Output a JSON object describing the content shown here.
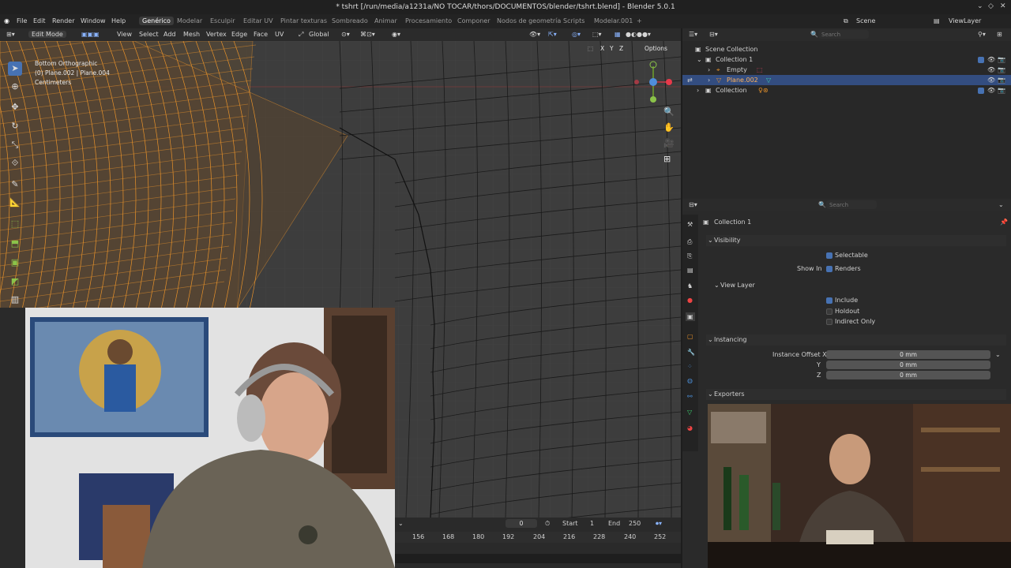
{
  "window": {
    "title": "* tshrt [/run/media/a1231a/NO TOCAR/thors/DOCUMENTOS/blender/tshrt.blend] - Blender 5.0.1"
  },
  "menu": {
    "items": [
      "File",
      "Edit",
      "Render",
      "Window",
      "Help"
    ],
    "workspaces": [
      "Genérico",
      "Modelar",
      "Esculpir",
      "Editar UV",
      "Pintar texturas",
      "Sombreado",
      "Animar",
      "Procesamiento",
      "Componer",
      "Nodos de geometría",
      "Scripts",
      "Modelar.001"
    ],
    "add_tab": "+",
    "scene_label": "Scene",
    "viewlayer_label": "ViewLayer"
  },
  "viewport_header": {
    "mode": "Edit Mode",
    "menus": [
      "View",
      "Select",
      "Add",
      "Mesh",
      "Vertex",
      "Edge",
      "Face",
      "UV"
    ],
    "orientation": "Global",
    "axes": [
      "X",
      "Y",
      "Z"
    ],
    "options_label": "Options"
  },
  "viewport": {
    "view_name": "Bottom Orthographic",
    "object_info": "(0) Plane.002 | Plane.004",
    "units": "Centimeters"
  },
  "outliner": {
    "search_placeholder": "Search",
    "root": "Scene Collection",
    "rows": [
      {
        "label": "Collection 1"
      },
      {
        "label": "Empty"
      },
      {
        "label": "Plane.002"
      },
      {
        "label": "Collection"
      }
    ]
  },
  "properties": {
    "search_placeholder": "Search",
    "context_title": "Collection 1",
    "visibility": {
      "header": "Visibility",
      "selectable": "Selectable",
      "show_in": "Show In",
      "renders": "Renders"
    },
    "view_layer": {
      "header": "View Layer",
      "include": "Include",
      "holdout": "Holdout",
      "indirect_only": "Indirect Only"
    },
    "instancing": {
      "header": "Instancing",
      "offset_label": "Instance Offset X",
      "y_label": "Y",
      "z_label": "Z",
      "x_value": "0 mm",
      "y_value": "0 mm",
      "z_value": "0 mm"
    },
    "exporters": {
      "header": "Exporters"
    }
  },
  "timeline": {
    "current_frame": "0",
    "start_label": "Start",
    "start_value": "1",
    "end_label": "End",
    "end_value": "250",
    "ticks": [
      "156",
      "168",
      "180",
      "192",
      "204",
      "216",
      "228",
      "240",
      "252"
    ]
  },
  "colors": {
    "accent": "#4772b3",
    "selected_row": "#334d80",
    "mesh_orange": "#e8922a",
    "viewport_bg": "#3d3d3d"
  }
}
